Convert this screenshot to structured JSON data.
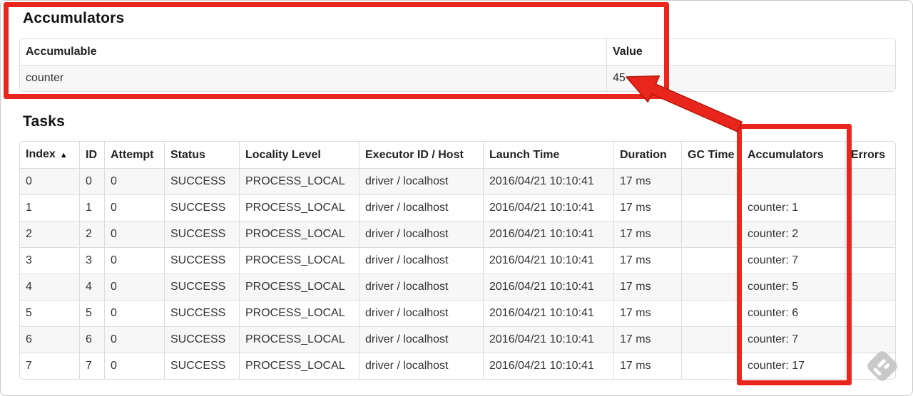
{
  "accumulators_section": {
    "title": "Accumulators",
    "table": {
      "headers": [
        "Accumulable",
        "Value"
      ],
      "rows": [
        [
          "counter",
          "45"
        ]
      ]
    }
  },
  "tasks_section": {
    "title": "Tasks",
    "table": {
      "headers": [
        "Index",
        "ID",
        "Attempt",
        "Status",
        "Locality Level",
        "Executor ID / Host",
        "Launch Time",
        "Duration",
        "GC Time",
        "Accumulators",
        "Errors"
      ],
      "column_keys": [
        "index",
        "id",
        "attempt",
        "status",
        "locality_level",
        "executor_id_host",
        "launch_time",
        "duration",
        "gc_time",
        "accumulators",
        "errors"
      ],
      "sort": {
        "column": "Index",
        "direction_icon": "▲"
      },
      "rows": [
        [
          "0",
          "0",
          "0",
          "SUCCESS",
          "PROCESS_LOCAL",
          "driver / localhost",
          "2016/04/21 10:10:41",
          "17 ms",
          "",
          "",
          ""
        ],
        [
          "1",
          "1",
          "0",
          "SUCCESS",
          "PROCESS_LOCAL",
          "driver / localhost",
          "2016/04/21 10:10:41",
          "17 ms",
          "",
          "counter: 1",
          ""
        ],
        [
          "2",
          "2",
          "0",
          "SUCCESS",
          "PROCESS_LOCAL",
          "driver / localhost",
          "2016/04/21 10:10:41",
          "17 ms",
          "",
          "counter: 2",
          ""
        ],
        [
          "3",
          "3",
          "0",
          "SUCCESS",
          "PROCESS_LOCAL",
          "driver / localhost",
          "2016/04/21 10:10:41",
          "17 ms",
          "",
          "counter: 7",
          ""
        ],
        [
          "4",
          "4",
          "0",
          "SUCCESS",
          "PROCESS_LOCAL",
          "driver / localhost",
          "2016/04/21 10:10:41",
          "17 ms",
          "",
          "counter: 5",
          ""
        ],
        [
          "5",
          "5",
          "0",
          "SUCCESS",
          "PROCESS_LOCAL",
          "driver / localhost",
          "2016/04/21 10:10:41",
          "17 ms",
          "",
          "counter: 6",
          ""
        ],
        [
          "6",
          "6",
          "0",
          "SUCCESS",
          "PROCESS_LOCAL",
          "driver / localhost",
          "2016/04/21 10:10:41",
          "17 ms",
          "",
          "counter: 7",
          ""
        ],
        [
          "7",
          "7",
          "0",
          "SUCCESS",
          "PROCESS_LOCAL",
          "driver / localhost",
          "2016/04/21 10:10:41",
          "17 ms",
          "",
          "counter: 17",
          ""
        ]
      ]
    }
  },
  "annotations": {
    "highlight_color": "#e8261c",
    "highlight_outline": "#b41508"
  },
  "watermark": {
    "icon_color": "#c9c9c9"
  }
}
